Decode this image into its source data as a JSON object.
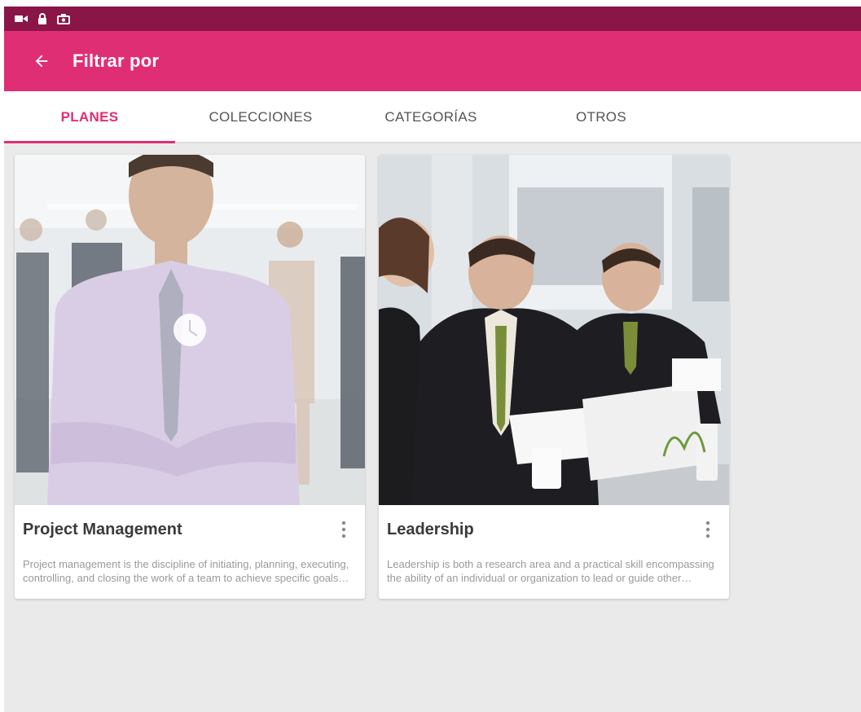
{
  "status_bar": {
    "icons": [
      "video-camera-icon",
      "lock-icon",
      "screenshot-icon"
    ]
  },
  "app_bar": {
    "title": "Filtrar por",
    "back_icon": "arrow-back-icon"
  },
  "tabs": [
    {
      "label": "PLANES",
      "active": true
    },
    {
      "label": "COLECCIONES",
      "active": false
    },
    {
      "label": "CATEGORÍAS",
      "active": false
    },
    {
      "label": "OTROS",
      "active": false
    }
  ],
  "cards": [
    {
      "title": "Project Management",
      "description": "Project management is the discipline of initiating, planning, executing, controlling, and closing the work of a team to achieve specific goals and meet specific success criteria.",
      "image": "business-team-photo",
      "menu_icon": "more-vertical-icon",
      "overlay_icon": "clock-icon"
    },
    {
      "title": "Leadership",
      "description": "Leadership is both a research area and a practical skill encompassing the ability of an individual or organization to lead or guide other individuals, teams, or entire organizations.",
      "image": "business-meeting-photo",
      "menu_icon": "more-vertical-icon"
    }
  ],
  "colors": {
    "status_bar": "#8a1547",
    "app_bar": "#e02e74",
    "accent": "#e02e74",
    "background": "#eaeaea"
  }
}
